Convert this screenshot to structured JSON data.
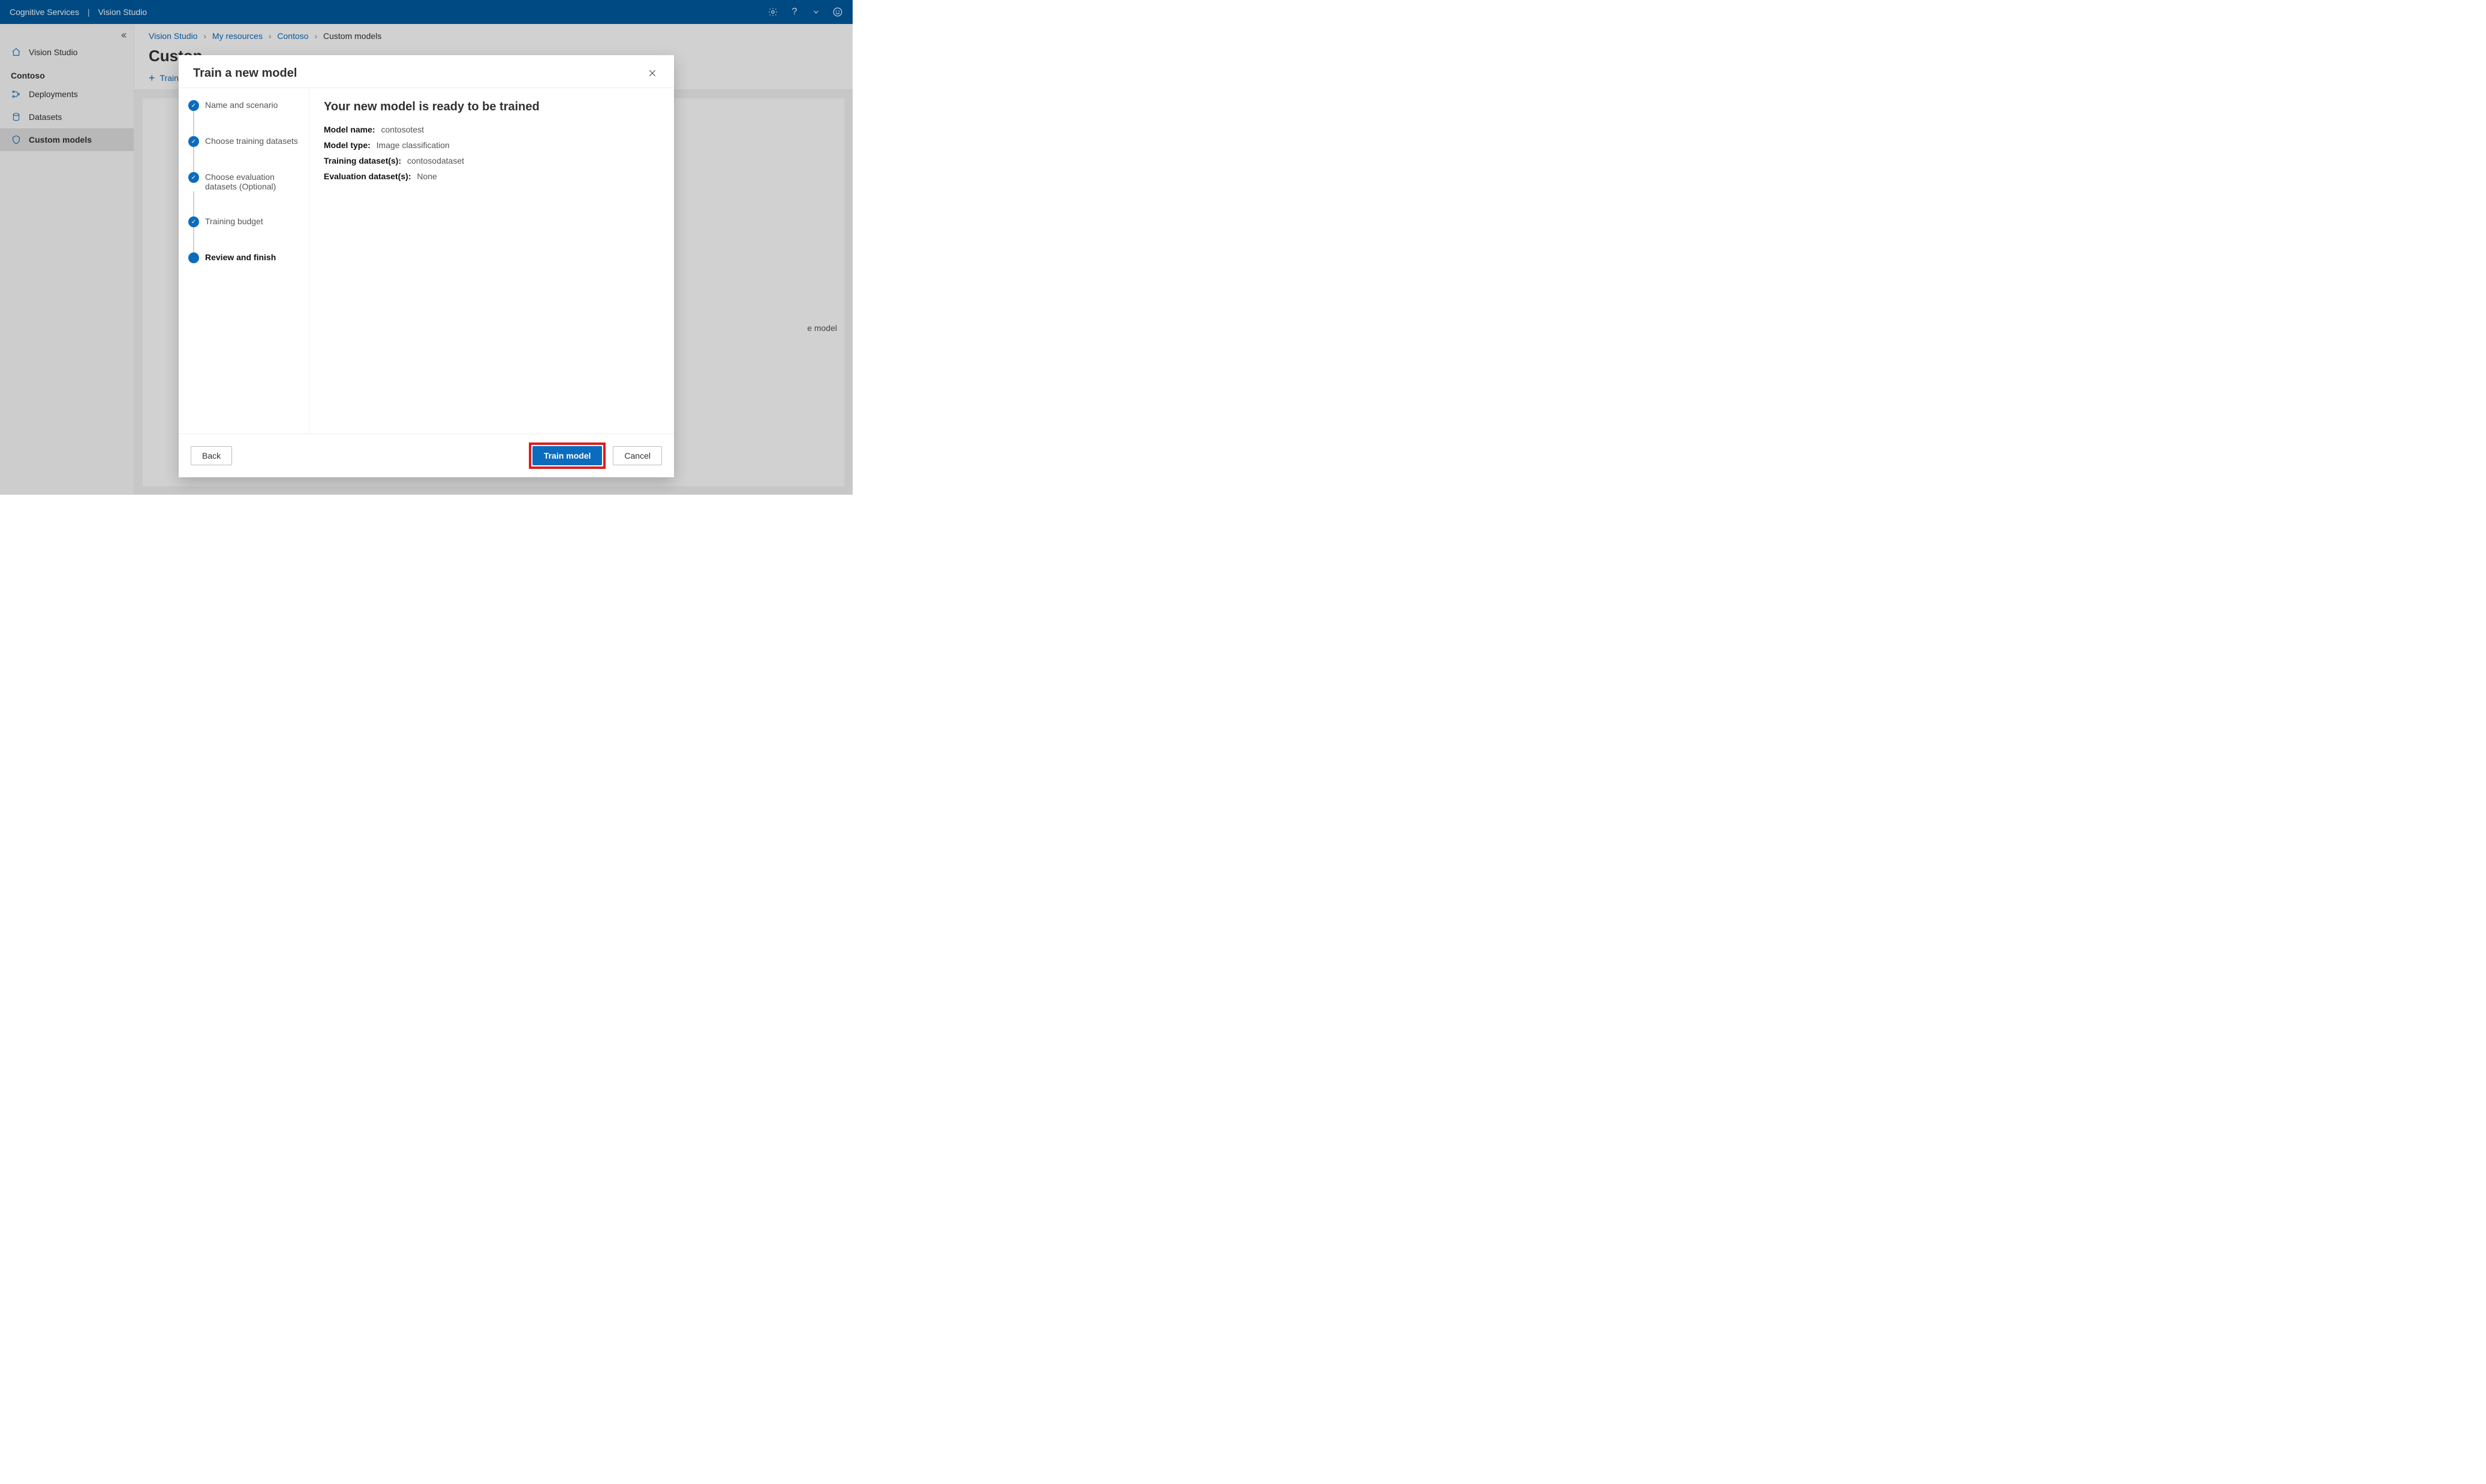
{
  "header": {
    "brand": "Cognitive Services",
    "product": "Vision Studio"
  },
  "sidebar": {
    "home": "Vision Studio",
    "resource": "Contoso",
    "items": [
      "Deployments",
      "Datasets",
      "Custom models"
    ]
  },
  "breadcrumbs": [
    "Vision Studio",
    "My resources",
    "Contoso",
    "Custom models"
  ],
  "page": {
    "title_truncated": "Custon",
    "toolbar_label_truncated": "Train a",
    "peek_text": "e model"
  },
  "modal": {
    "title": "Train a new model",
    "steps": [
      "Name and scenario",
      "Choose training datasets",
      "Choose evaluation datasets (Optional)",
      "Training budget",
      "Review and finish"
    ],
    "review_heading": "Your new model is ready to be trained",
    "kv": [
      {
        "k": "Model name:",
        "v": "contosotest"
      },
      {
        "k": "Model type:",
        "v": "Image classification"
      },
      {
        "k": "Training dataset(s):",
        "v": "contosodataset"
      },
      {
        "k": "Evaluation dataset(s):",
        "v": "None"
      }
    ],
    "buttons": {
      "back": "Back",
      "train": "Train model",
      "cancel": "Cancel"
    }
  }
}
